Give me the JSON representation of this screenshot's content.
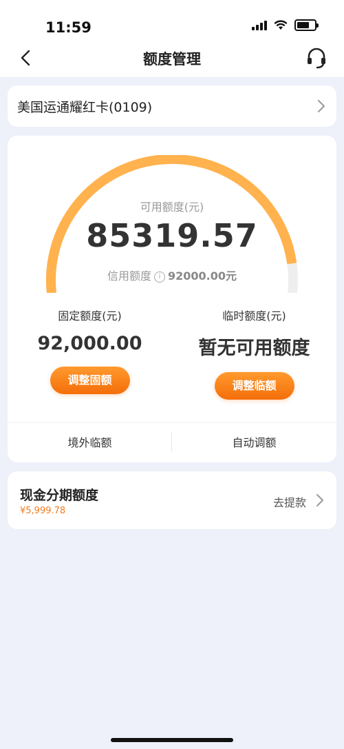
{
  "status_bar": {
    "time": "11:59"
  },
  "nav": {
    "title": "额度管理"
  },
  "card_selector": {
    "name": "美国运通耀红卡(0109)"
  },
  "credit": {
    "available_label": "可用额度(元)",
    "available_value": "85319.57",
    "credit_limit_label": "信用额度",
    "credit_limit_value": "92000.00元",
    "available_fraction": 0.927
  },
  "fixed": {
    "label": "固定额度(元)",
    "value": "92,000.00",
    "button": "调整固额"
  },
  "temporary": {
    "label": "临时额度(元)",
    "value": "暂无可用额度",
    "button": "调整临额"
  },
  "links": {
    "overseas": "境外临额",
    "auto": "自动调额"
  },
  "cash_installment": {
    "title": "现金分期额度",
    "amount": "¥5,999.78",
    "action": "去提款"
  },
  "colors": {
    "accent": "#f46e0a",
    "gauge_fill": "#ffb24d",
    "gauge_track": "#eeeeee",
    "background": "#eef0fa"
  }
}
